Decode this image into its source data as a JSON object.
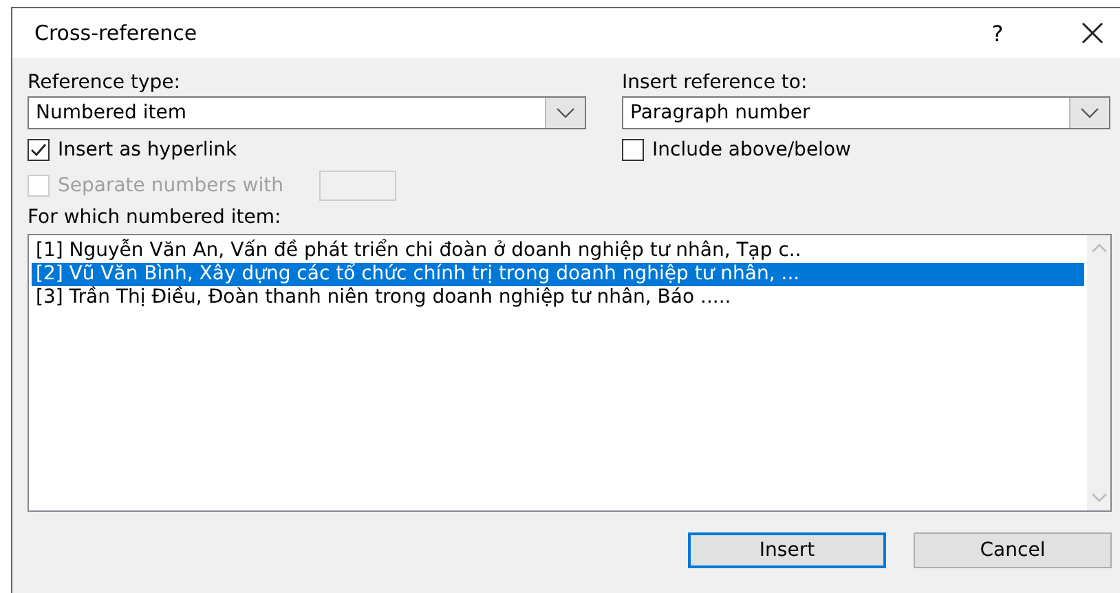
{
  "window": {
    "title": "Cross-reference",
    "help": "?"
  },
  "reference_type": {
    "label": "Reference type:",
    "value": "Numbered item"
  },
  "insert_reference_to": {
    "label": "Insert reference to:",
    "value": "Paragraph number"
  },
  "checkboxes": [
    {
      "label": "Insert as hyperlink",
      "checked": true,
      "disabled": false
    },
    {
      "label": "Include above/below",
      "checked": false,
      "disabled": false
    },
    {
      "label": "Separate numbers with",
      "checked": false,
      "disabled": true
    }
  ],
  "list": {
    "label": "For which numbered item:",
    "items": [
      {
        "text": "[1] Nguyễn Văn An, Vấn đề phát triển chi đoàn ở doanh nghiệp tư nhân, Tạp c..",
        "selected": false
      },
      {
        "text": "[2] Vũ Văn Bình, Xây dựng các tổ chức chính trị trong doanh nghiệp tư nhân, ...",
        "selected": true
      },
      {
        "text": "[3] Trần Thị Điều, Đoàn thanh niên trong doanh nghiệp tư nhân, Báo .....",
        "selected": false
      }
    ]
  },
  "buttons": [
    {
      "label": "Insert",
      "default": true
    },
    {
      "label": "Cancel",
      "default": false
    }
  ]
}
